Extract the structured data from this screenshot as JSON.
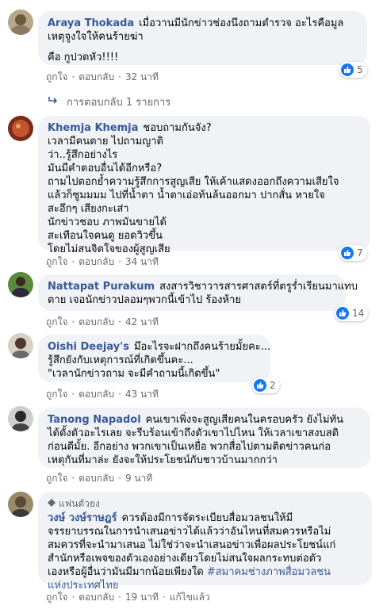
{
  "comments": [
    {
      "name": "Araya Thokada",
      "lines": [
        "เมื่อวานมีนักข่าวช่องนึงถามตำรวจ อะไรคือมูล",
        "เหตุจูงใจให้คนร้ายฆ่า",
        "",
        "คือ กูปวดหัว!!!!"
      ],
      "like": "ถูกใจ",
      "reply": "ตอบกลับ",
      "time": "32 นาที",
      "reactions": "5"
    },
    {
      "name": "Khemja Khemja",
      "lines": [
        "ชอบถามกันจัง?",
        "เวลามีคนตาย ไปถามญาติ",
        "ว่า..รู้สึกอย่างไร",
        "มันมีคำตอบอื่นได้อีกหรือ?",
        "ถามไปตอกย้ำความรู้สึกการสูญเสีย ให้เค้าแสดงออกถึงความเสียใจ",
        "แล้วก็ซูมมมม ไปที่น้ำตา น้ำตาเอ่อท้นล้นออกมา ปากสั่น หายใจ",
        "สะอึกๆ เสียงกะเส่า",
        "นักข่าวชอบ ภาพมันขายได้",
        "สะเทือนใจคนดู ยอดวิวขึ้น",
        "โดยไม่สนจิตใจของผู้สูญเสีย"
      ],
      "like": "ถูกใจ",
      "reply": "ตอบกลับ",
      "time": "34 นาที",
      "reactions": "7"
    },
    {
      "name": "Nattapat Purakum",
      "lines": [
        "สงสารวิชาวารสารศาสตร์ที่ตรูร่ำเรียนมาแทบ",
        "ตาย เจอนักข่าวปลอมๆพวกนี้เข้าไป ร้องห้าย"
      ],
      "like": "ถูกใจ",
      "reply": "ตอบกลับ",
      "time": "42 นาที",
      "reactions": "14"
    },
    {
      "name": "Oishi Deejay's",
      "lines": [
        "มึอะไรจะฝากถึงคนร้ายมั้ยคะ...",
        "รู้สึกยังกับเหตุการณ์ที่เกิดขึ้นคะ...",
        "\"เวลานักข่าวถาม จะมีคำถามนี้เกิดขึ้น\""
      ],
      "like": "ถูกใจ",
      "reply": "ตอบกลับ",
      "time": "43 นาที",
      "reactions": "2"
    },
    {
      "name": "Tanong Napadol",
      "lines": [
        "คนเขาเพิ่งจะสูญเสียคนในครอบครัว ยังไม่ทัน",
        "ได้ตั้งตัวอะไรเลย จะรีบร้อนเข้าถึงตัวเขาไปไหน ให้เวลาเขาสงบสติ",
        "ก่อนดีมั้ย. อีกอย่าง พวกเขาเป็นเหยื่อ พวกสื่อไปตามติดข่าวคนก่อ",
        "เหตุกันที่มาล่ะ ยังจะให้ประโยชน์กับชาวบ้านมากกว่า"
      ],
      "like": "ถูกใจ",
      "reply": "ตอบกลับ",
      "time": "9 นาที"
    },
    {
      "badge": "แฟนตัวยง",
      "name": "วงษ์ วงษ์ราษฎร์",
      "lines": [
        "ควรต้องมีการจัดระเบียบสื่อมวลชนให้มี",
        "จรรยาบรรณในการนำเสนอข่าวได้แล้วว่าอันไหนที่สมควรหรือไม่",
        "สมควรที่จะนำมาเสนอ ไม่ใช่ว่าจะนำเสนอข่าวเพื่อผลประโยชน์แก่",
        "สำนักหรือเพจของตัวเองอย่างเดียวโดยไม่สนใจผลกระทบต่อตัว",
        "เองหรือผู้อื่นว่ามันมีมากน้อยเพียงใด"
      ],
      "hashtag": "#สมาคมช่างภาพสื่อมวลชน",
      "hashtag_line2": "แห่งประเทศไทย",
      "like": "ถูกใจ",
      "reply": "ตอบกลับ",
      "time": "19 นาที",
      "edited": "แก้ไขแล้ว"
    }
  ],
  "replies_link": "การตอบกลับ 1 รายการ",
  "colors": {
    "name": "#385898",
    "bubble": "#f0f2f5",
    "meta": "#65676b",
    "like": "#1877f2"
  }
}
